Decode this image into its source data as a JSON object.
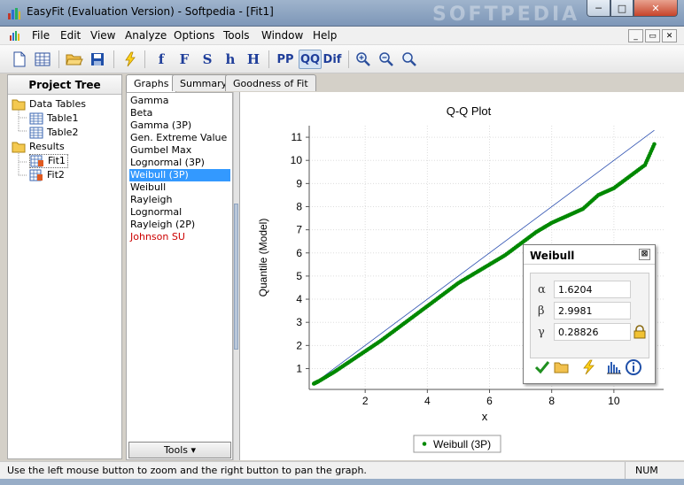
{
  "window": {
    "title": "EasyFit (Evaluation Version) - Softpedia - [Fit1]",
    "min": "─",
    "max": "□",
    "close": "✕",
    "watermark": "SOFTPEDIA"
  },
  "menu": {
    "items": [
      "File",
      "Edit",
      "View",
      "Analyze",
      "Options",
      "Tools",
      "Window",
      "Help"
    ],
    "mdi": [
      "_",
      "▭",
      "✕"
    ]
  },
  "toolbar": {
    "buttons": [
      "f",
      "F",
      "S",
      "h",
      "H",
      "PP",
      "QQ",
      "Dif"
    ]
  },
  "project_tree": {
    "header": "Project Tree",
    "items": [
      {
        "label": "Data Tables",
        "icon": "folder-icon"
      },
      {
        "label": "Table1",
        "icon": "table-icon"
      },
      {
        "label": "Table2",
        "icon": "table-icon"
      },
      {
        "label": "Results",
        "icon": "folder-icon"
      },
      {
        "label": "Fit1",
        "icon": "fit-result-icon"
      },
      {
        "label": "Fit2",
        "icon": "fit-result-icon"
      }
    ]
  },
  "tabs": [
    "Graphs",
    "Summary",
    "Goodness of Fit"
  ],
  "distributions": [
    "Gamma",
    "Beta",
    "Gamma (3P)",
    "Gen. Extreme Value",
    "Gumbel Max",
    "Lognormal (3P)",
    "Weibull (3P)",
    "Weibull",
    "Rayleigh",
    "Lognormal",
    "Rayleigh (2P)",
    "Johnson SU"
  ],
  "tools_button": "Tools ▾",
  "chart_data": {
    "type": "scatter",
    "title": "Q-Q Plot",
    "xlabel": "x",
    "ylabel": "Quantile (Model)",
    "xlim": [
      0.2,
      11.6
    ],
    "ylim": [
      0.1,
      11.5
    ],
    "x_ticks": [
      2,
      4,
      6,
      8,
      10
    ],
    "y_ticks": [
      1,
      2,
      3,
      4,
      5,
      6,
      7,
      8,
      9,
      10,
      11
    ],
    "grid": true,
    "reference_line": [
      [
        0.3,
        0.3
      ],
      [
        11.3,
        11.3
      ]
    ],
    "series": [
      {
        "name": "Weibull (3P)",
        "color": "#008800",
        "points": [
          [
            0.35,
            0.35
          ],
          [
            0.5,
            0.45
          ],
          [
            1,
            0.85
          ],
          [
            1.5,
            1.3
          ],
          [
            2,
            1.75
          ],
          [
            2.5,
            2.2
          ],
          [
            3,
            2.7
          ],
          [
            3.5,
            3.2
          ],
          [
            4,
            3.7
          ],
          [
            4.5,
            4.2
          ],
          [
            5,
            4.7
          ],
          [
            5.5,
            5.1
          ],
          [
            6,
            5.5
          ],
          [
            6.5,
            5.9
          ],
          [
            7,
            6.4
          ],
          [
            7.5,
            6.9
          ],
          [
            8,
            7.3
          ],
          [
            8.5,
            7.6
          ],
          [
            9,
            7.9
          ],
          [
            9.5,
            8.5
          ],
          [
            10,
            8.8
          ],
          [
            10.5,
            9.3
          ],
          [
            11,
            9.8
          ],
          [
            11.3,
            10.7
          ]
        ]
      }
    ],
    "legend": "bottom-center"
  },
  "params": {
    "title": "Weibull",
    "close": "⊠",
    "rows": [
      {
        "symbol": "α",
        "value": "1.6204"
      },
      {
        "symbol": "β",
        "value": "2.9981"
      },
      {
        "symbol": "γ",
        "value": "0.28826"
      }
    ]
  },
  "status": {
    "text": "Use the left mouse button to zoom and the right button to pan the graph.",
    "num": "NUM"
  }
}
